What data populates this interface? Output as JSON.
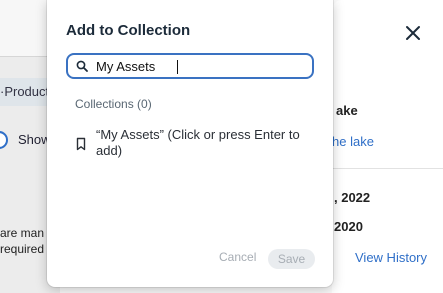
{
  "background": {
    "left": {
      "product_chip": "·Product",
      "toggle_label": "Show",
      "note_line1": "are man",
      "note_line2": "required"
    },
    "right": {
      "lake_title": "ake",
      "lake_link": "he lake",
      "date1": ", 2022",
      "date2": "2020",
      "history_link": "View History"
    }
  },
  "modal": {
    "title": "Add to Collection",
    "search": {
      "value": "My Assets",
      "placeholder": ""
    },
    "collections_label": "Collections (0)",
    "suggestion": "“My Assets” (Click or press Enter to add)",
    "cancel_label": "Cancel",
    "save_label": "Save"
  },
  "colors": {
    "accent": "#3a72c2",
    "link": "#2f6fc8",
    "disabled_text": "#a7adb4"
  },
  "icons": {
    "search": "search-icon",
    "bookmark": "bookmark-icon",
    "close": "close-icon"
  }
}
